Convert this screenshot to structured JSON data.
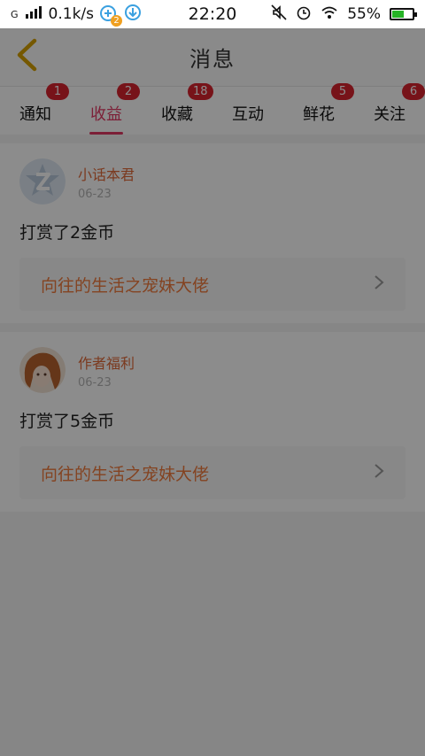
{
  "status_bar": {
    "network": "G",
    "speed": "0.1k/s",
    "notif_count": "2",
    "time": "22:20",
    "battery": "55%",
    "battery_level": 0.55,
    "battery_color": "#26b326"
  },
  "header": {
    "title": "消息",
    "back_icon": "chevron-left-icon"
  },
  "tabs": [
    {
      "label": "通知",
      "badge": "1"
    },
    {
      "label": "收益",
      "badge": "2",
      "active": true
    },
    {
      "label": "收藏",
      "badge": "18"
    },
    {
      "label": "互动",
      "badge": ""
    },
    {
      "label": "鲜花",
      "badge": "5"
    },
    {
      "label": "关注",
      "badge": "6"
    }
  ],
  "messages": [
    {
      "user": "小话本君",
      "date": "06-23",
      "text": "打赏了2金币",
      "book": "向往的生活之宠妹大佬"
    },
    {
      "user": "作者福利",
      "date": "06-23",
      "text": "打赏了5金币",
      "book": "向往的生活之宠妹大佬"
    }
  ],
  "colors": {
    "accent": "#e23a64",
    "badge": "#d9232f",
    "username": "#e06a3a",
    "book_title": "#f07a3c",
    "back_arrow": "#d6a000"
  }
}
